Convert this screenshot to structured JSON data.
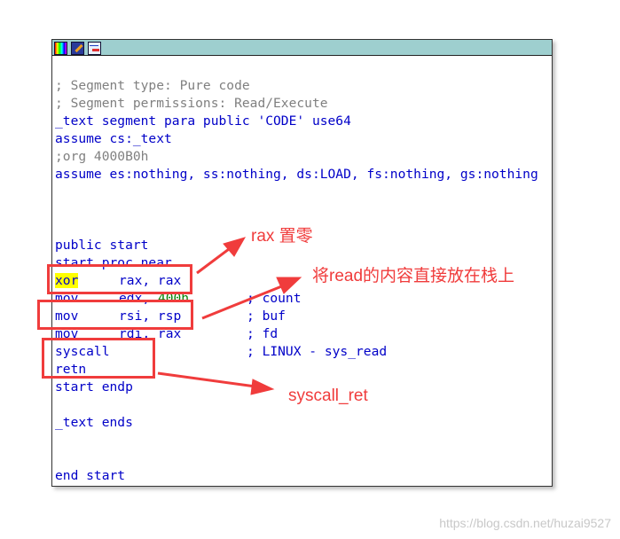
{
  "toolbar": {
    "icons": [
      "palette-icon",
      "edit-pencil-icon",
      "graph-view-icon"
    ]
  },
  "code": {
    "seg_type": "; Segment type: Pure code",
    "seg_perm": "; Segment permissions: Read/Execute",
    "segment": "_text segment para public 'CODE' use64",
    "assume_cs": "assume cs:_text",
    "org": ";org 4000B0h",
    "assume_es": "assume es:nothing, ss:nothing, ds:LOAD, fs:nothing, gs:nothing",
    "public": "public start",
    "proc": "start proc near",
    "ins": [
      {
        "op": "xor",
        "args": "rax, rax",
        "comment": ""
      },
      {
        "op": "mov",
        "args": "edx, ",
        "num": "400h",
        "comment": "; count"
      },
      {
        "op": "mov",
        "args": "rsi, rsp",
        "comment": "; buf"
      },
      {
        "op": "mov",
        "args": "rdi, rax",
        "comment": "; fd"
      },
      {
        "op": "syscall",
        "args": "",
        "comment": "; LINUX - sys_read"
      },
      {
        "op": "retn",
        "args": "",
        "comment": ""
      }
    ],
    "endp": "start endp",
    "ends": "_text ends",
    "end": "end start"
  },
  "annotations": {
    "a1": "rax 置零",
    "a2": "将read的内容直接放在栈上",
    "a3": "syscall_ret",
    "color": "#f03c3c"
  },
  "watermark": "https://blog.csdn.net/huzai9527"
}
